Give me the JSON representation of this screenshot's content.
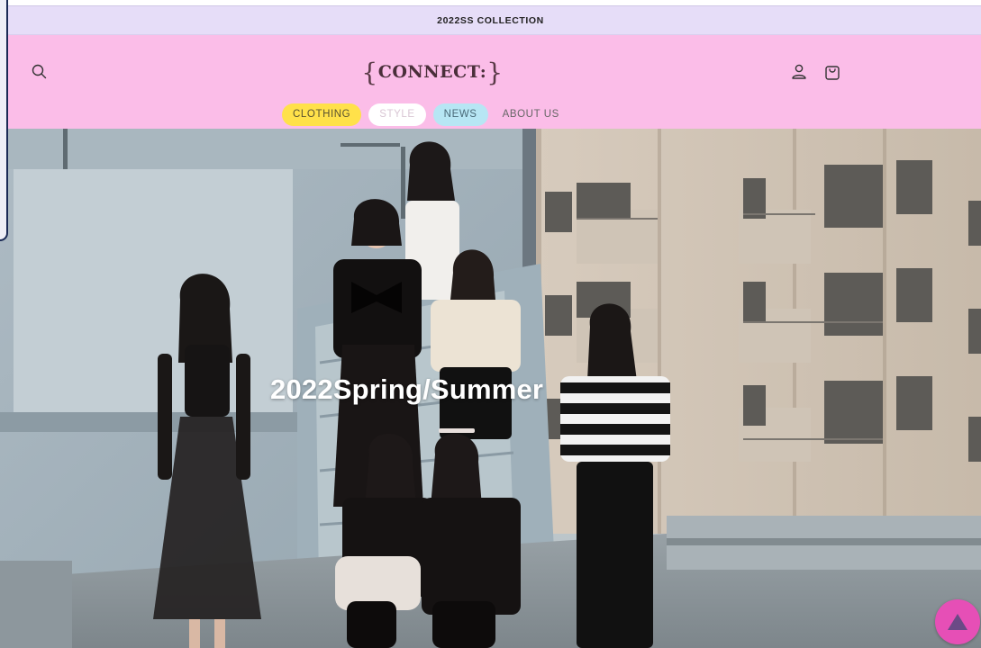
{
  "announcement": {
    "text": "2022SS COLLECTION"
  },
  "header": {
    "logo_text": "CONNECT:",
    "logo_open": "{",
    "logo_close": "}",
    "search_icon": "search-icon",
    "account_icon": "user-icon",
    "cart_icon": "shopping-bag-icon"
  },
  "nav": {
    "items": [
      {
        "label": "CLOTHING",
        "color": "#ffe14a"
      },
      {
        "label": "STYLE",
        "color": "#ffffff"
      },
      {
        "label": "NEWS",
        "color": "#b7e6f4"
      },
      {
        "label": "ABOUT US",
        "color": ""
      }
    ]
  },
  "hero": {
    "title": "2022Spring/Summer"
  },
  "fab": {
    "icon": "triangle-up-icon",
    "color": "#e64fb6"
  },
  "colors": {
    "announce_bg": "#e6ddf8",
    "header_bg": "#fbbde8",
    "frame": "#1b2a55"
  }
}
